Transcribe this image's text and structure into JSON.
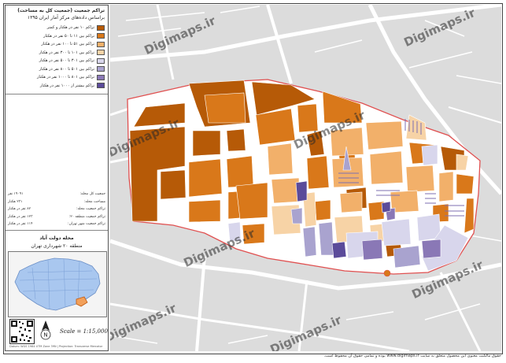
{
  "title": {
    "line1": "تراکم جمعیت (جمعیت کل به مساحت)",
    "line2": "براساس داده‌های مرکز آمار ایران ۱۳۹۵"
  },
  "legend": [
    {
      "label": "تراکم ۱۰ نفر در هکتار و کمتر",
      "color": "#b65a07"
    },
    {
      "label": "تراکم بین ۱۱ تا ۵۰ نفر در هکتار",
      "color": "#d9781a"
    },
    {
      "label": "تراکم بین ۵۱ تا ۱۰۰ نفر در هکتار",
      "color": "#f2b06a"
    },
    {
      "label": "تراکم بین ۱۰۱ تا ۳۰۰ نفر در هکتار",
      "color": "#f7d3a6"
    },
    {
      "label": "تراکم بین ۳۰۱ تا ۵۰۰ نفر در هکتار",
      "color": "#d8d6ec"
    },
    {
      "label": "تراکم بین ۵۰۱ تا ۸۰۰ نفر در هکتار",
      "color": "#a9a3cf"
    },
    {
      "label": "تراکم بین ۸۰۱ تا ۱۰۰۰ نفر در هکتار",
      "color": "#8a78b6"
    },
    {
      "label": "تراکم بیشتر از ۱۰۰۰ نفر در هکتار",
      "color": "#5b4b9a"
    }
  ],
  "stats": [
    {
      "label": "جمعیت کل محله:",
      "value": "۱۹۰۹۱ نفر"
    },
    {
      "label": "مساحت محله:",
      "value": "۲۳۱ هکتار"
    },
    {
      "label": "تراکم جمعیت محله:",
      "value": "۸۲ نفر در هکتار"
    },
    {
      "label": "تراکم جمعیت منطقه ۲۰:",
      "value": "۱۲۳ نفر در هکتار"
    },
    {
      "label": "تراکم جمعیت شهر تهران:",
      "value": "۱۱۴ نفر در هکتار"
    }
  ],
  "place": {
    "name": "محله دولت آباد",
    "district": "منطقه ۲۰ شهرداری تهران"
  },
  "scale": "Scale = 1:15,000",
  "north_label": "N",
  "small_note": "Datum: WGS 1984 UTM Zone 39N | Projection: Transverse Mercator",
  "watermark": "Digimaps.ir",
  "copyright": "حقوق مالکیت معنوی این محصول متعلق به سایت www.digimaps.ir بوده و تمامی حقوق آن محفوظ است.",
  "colors": {
    "boundary": "#e05050",
    "road": "#ffffff",
    "base": "#dcdcdc",
    "inset_district": "#a9c7ef",
    "inset_highlight": "#f2a05a"
  }
}
